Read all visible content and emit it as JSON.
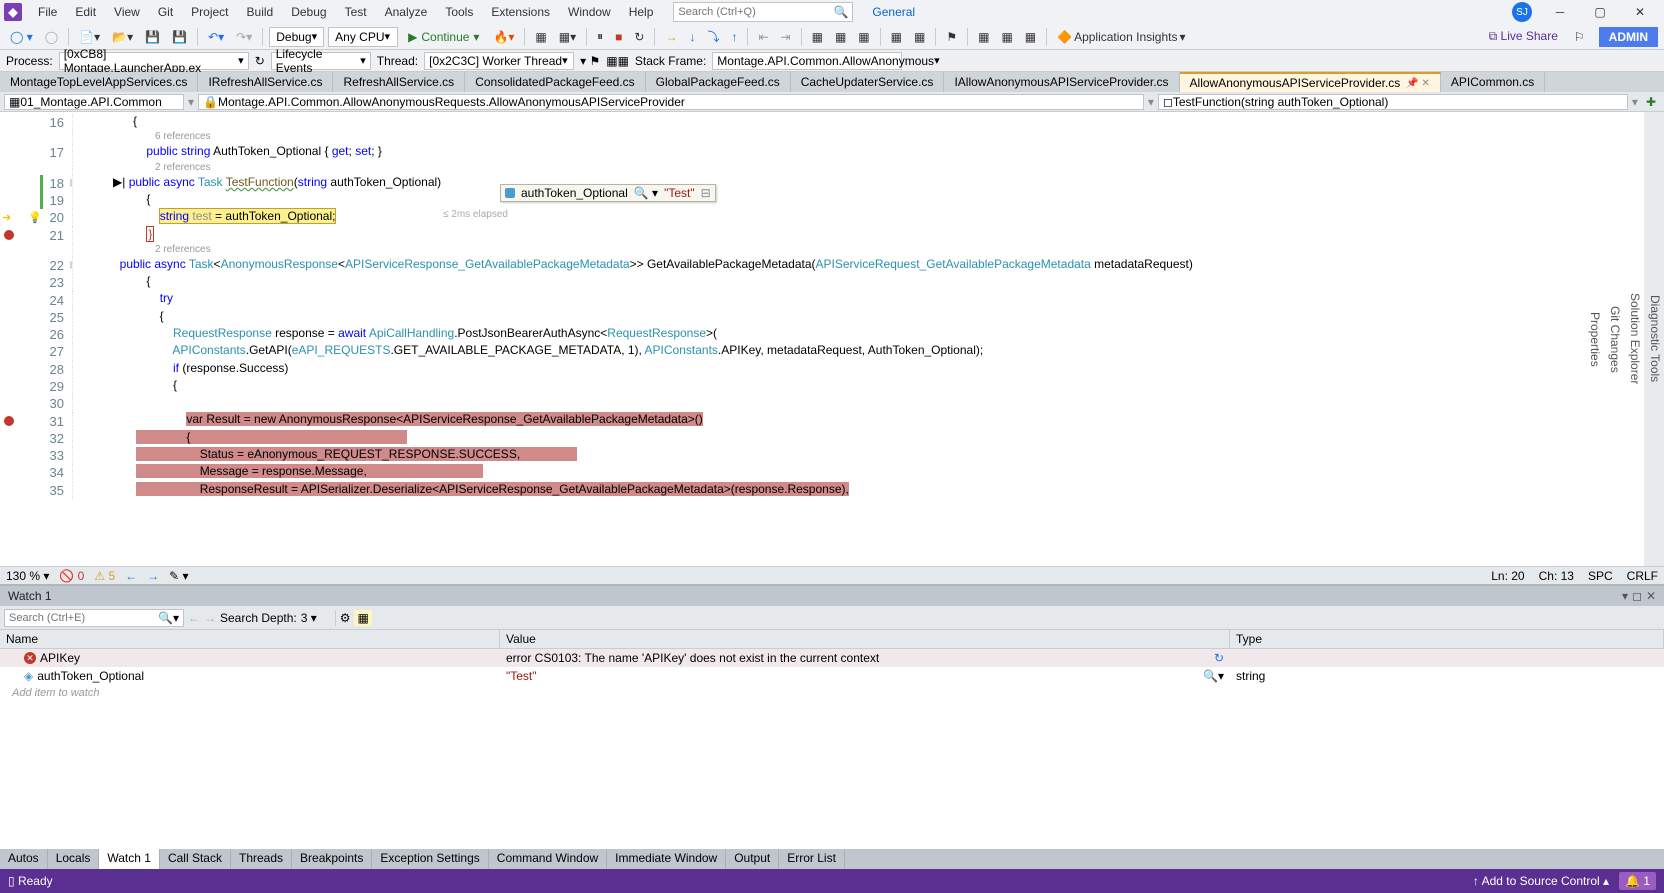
{
  "title": {
    "search_placeholder": "Search (Ctrl+Q)",
    "general": "General",
    "avatar": "SJ"
  },
  "menus": [
    "File",
    "Edit",
    "View",
    "Git",
    "Project",
    "Build",
    "Debug",
    "Test",
    "Analyze",
    "Tools",
    "Extensions",
    "Window",
    "Help"
  ],
  "toolbar": {
    "config": "Debug",
    "platform": "Any CPU",
    "continue": "Continue",
    "insights": "Application Insights",
    "liveshare": "Live Share",
    "admin": "ADMIN"
  },
  "debugbar": {
    "process_lbl": "Process:",
    "process": "[0xCB8] Montage.LauncherApp.ex",
    "lifecycle": "Lifecycle Events",
    "thread_lbl": "Thread:",
    "thread": "[0x2C3C] Worker Thread",
    "stack_lbl": "Stack Frame:",
    "stack": "Montage.API.Common.AllowAnonymous"
  },
  "tabs": [
    {
      "label": "MontageTopLevelAppServices.cs"
    },
    {
      "label": "IRefreshAllService.cs"
    },
    {
      "label": "RefreshAllService.cs"
    },
    {
      "label": "ConsolidatedPackageFeed.cs"
    },
    {
      "label": "GlobalPackageFeed.cs"
    },
    {
      "label": "CacheUpdaterService.cs"
    },
    {
      "label": "IAllowAnonymousAPIServiceProvider.cs"
    },
    {
      "label": "AllowAnonymousAPIServiceProvider.cs",
      "active": true
    },
    {
      "label": "APICommon.cs"
    }
  ],
  "nav": {
    "proj": "01_Montage.API.Common",
    "type": "Montage.API.Common.AllowAnonymousRequests.AllowAnonymousAPIServiceProvider",
    "member": "TestFunction(string authToken_Optional)"
  },
  "code": {
    "ref1": "6 references",
    "ref2": "2 references",
    "ref3": "2 references",
    "l16": "            {",
    "l17_a": "                public string ",
    "l17_b": "AuthToken_Optional",
    "l17_c": " { get; set; }",
    "l18_a": "                public async ",
    "l18_task": "Task",
    "l18_b": " ",
    "l18_fn": "TestFunction",
    "l18_c": "(string authToken_Optional)",
    "l19": "                {",
    "l20_a": "                    ",
    "l20_stmt": "string test = authToken_Optional;",
    "l21_a": "                ",
    "l21_b": "}",
    "l22_a": "                public async ",
    "l22_task": "Task",
    "l22_b": "<",
    "l22_ar": "AnonymousResponse",
    "l22_c": "<",
    "l22_t1": "APIServiceResponse_GetAvailablePackageMetadata",
    "l22_d": ">> GetAvailablePackageMetadata(",
    "l22_t2": "APIServiceRequest_GetAvailablePackageMetadata",
    "l22_e": " metadataRequest)",
    "l23": "                {",
    "l24": "                    try",
    "l25": "                    {",
    "l26_a": "                        ",
    "l26_rr": "RequestResponse",
    "l26_b": " response = await ",
    "l26_ach": "ApiCallHandling",
    "l26_c": ".PostJsonBearerAuthAsync<",
    "l26_rr2": "RequestResponse",
    "l26_d": ">(",
    "l27_a": "                        ",
    "l27_ac": "APIConstants",
    "l27_b": ".GetAPI(",
    "l27_enum": "eAPI_REQUESTS",
    "l27_c": ".GET_AVAILABLE_PACKAGE_METADATA, 1), ",
    "l27_ac2": "APIConstants",
    "l27_d": ".APIKey, metadataRequest, AuthToken_Optional);",
    "l28": "                        if (response.Success)",
    "l29": "                        {",
    "l30": "",
    "l31": "                            var Result = new AnonymousResponse<APIServiceResponse_GetAvailablePackageMetadata>()",
    "l32": "                            {",
    "l33": "                                Status = eAnonymous_REQUEST_RESPONSE.SUCCESS,",
    "l34": "                                Message = response.Message,",
    "l35": "                                ResponseResult = APISerializer.Deserialize<APIServiceResponse_GetAvailablePackageMetadata>(response.Response),"
  },
  "datatip": {
    "name": "authToken_Optional",
    "value": "\"Test\""
  },
  "elapsed": "≤ 2ms elapsed",
  "estatus": {
    "zoom": "130 %",
    "err": "0",
    "warn": "5",
    "ln": "Ln: 20",
    "ch": "Ch: 13",
    "spc": "SPC",
    "crlf": "CRLF"
  },
  "watch": {
    "title": "Watch 1",
    "search_placeholder": "Search (Ctrl+E)",
    "depth_lbl": "Search Depth:",
    "depth": "3",
    "cols": {
      "name": "Name",
      "value": "Value",
      "type": "Type"
    },
    "rows": [
      {
        "name": "APIKey",
        "value": "error CS0103: The name 'APIKey' does not exist in the current context",
        "type": "",
        "err": true
      },
      {
        "name": "authToken_Optional",
        "value": "\"Test\"",
        "type": "string",
        "err": false
      }
    ],
    "additem": "Add item to watch"
  },
  "bottomtabs": [
    "Autos",
    "Locals",
    "Watch 1",
    "Call Stack",
    "Threads",
    "Breakpoints",
    "Exception Settings",
    "Command Window",
    "Immediate Window",
    "Output",
    "Error List"
  ],
  "statusbar": {
    "ready": "Ready",
    "src": "Add to Source Control",
    "bell": "1"
  },
  "sidepanels": [
    "Diagnostic Tools",
    "Solution Explorer",
    "Git Changes",
    "Properties"
  ]
}
